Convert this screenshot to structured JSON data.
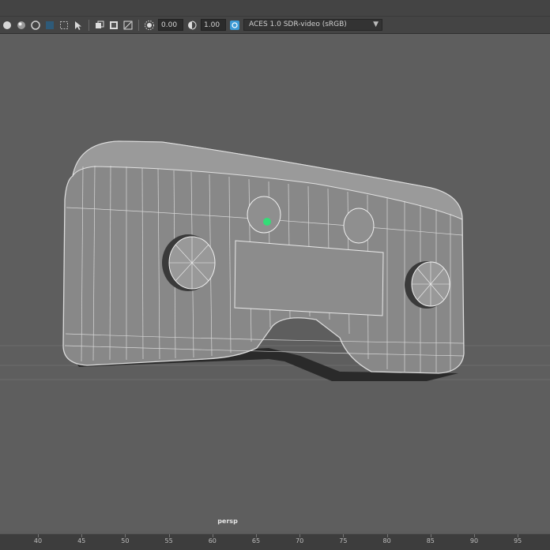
{
  "toolbar": {
    "exposure_value": "0.00",
    "gamma_value": "1.00",
    "color_management": {
      "selected": "ACES 1.0 SDR-video (sRGB)",
      "icon": "color-management-icon"
    },
    "icons": [
      "shaded-sphere-icon",
      "lit-sphere-icon",
      "wireframe-circle-icon",
      "grid-square-icon",
      "select-box-icon",
      "frame-selection-icon",
      "isolate-icon",
      "texture-icon",
      "exposure-icon",
      "gamma-icon"
    ],
    "colors": {
      "bar": "#444444",
      "field": "#2b2b2b",
      "accent": "#3c9bd6"
    }
  },
  "viewport": {
    "camera_label": "persp",
    "background": "#5e5e5e",
    "selection_color": "#33dd77"
  },
  "timeline": {
    "ticks": [
      "40",
      "45",
      "50",
      "55",
      "60",
      "65",
      "70",
      "75",
      "80",
      "85",
      "90",
      "95"
    ]
  }
}
